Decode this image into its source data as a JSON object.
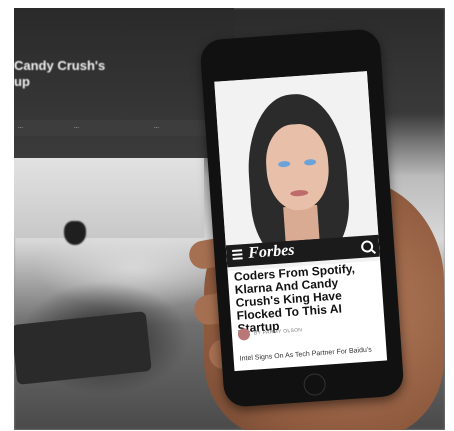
{
  "photo": {
    "monitor_headline": "Candy Crush's\nup",
    "monitor_bar_items": [
      "...",
      "...",
      "..."
    ]
  },
  "phone": {
    "nav": {
      "brand": "Forbes",
      "menu_icon": "hamburger-icon",
      "search_icon": "search-icon"
    },
    "article": {
      "headline": "Coders From Spotify, Klarna And Candy Crush's King Have Flocked To This AI Startup",
      "byline": "BY PARMY OLSON",
      "next_headline": "Intel Signs On As Tech Partner For Baidu's"
    }
  },
  "colors": {
    "accent": "#3fd1f2",
    "nav_bg": "#1b1b1b"
  }
}
